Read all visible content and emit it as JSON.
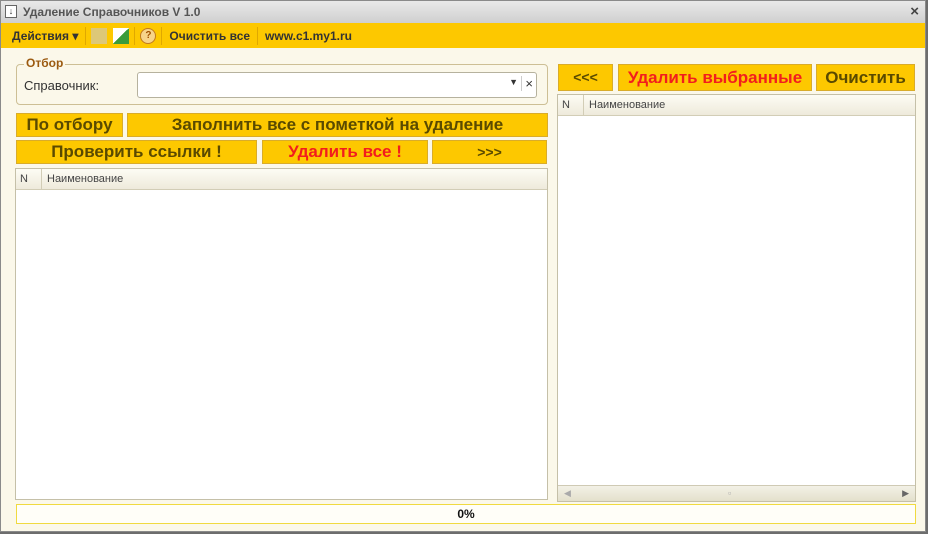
{
  "window": {
    "title": "Удаление Справочников V 1.0",
    "close": "×"
  },
  "toolbar": {
    "actions": "Действия ▾",
    "clear_all": "Очистить все",
    "site": "www.c1.my1.ru"
  },
  "filter": {
    "group_label": "Отбор",
    "field_label": "Справочник:",
    "value": ""
  },
  "buttons": {
    "by_filter": "По отбору",
    "fill_marked": "Заполнить все с пометкой на удаление",
    "check_links": "Проверить ссылки  !",
    "delete_all": "Удалить все !",
    "move_right": ">>>",
    "move_left": "<<<",
    "delete_selected": "Удалить выбранные",
    "clear": "Очистить"
  },
  "left_table": {
    "columns": [
      "N",
      "Наименование"
    ],
    "rows": []
  },
  "right_table": {
    "columns": [
      "N",
      "Наименование"
    ],
    "rows": []
  },
  "progress": {
    "value": 0,
    "label": "0%"
  }
}
